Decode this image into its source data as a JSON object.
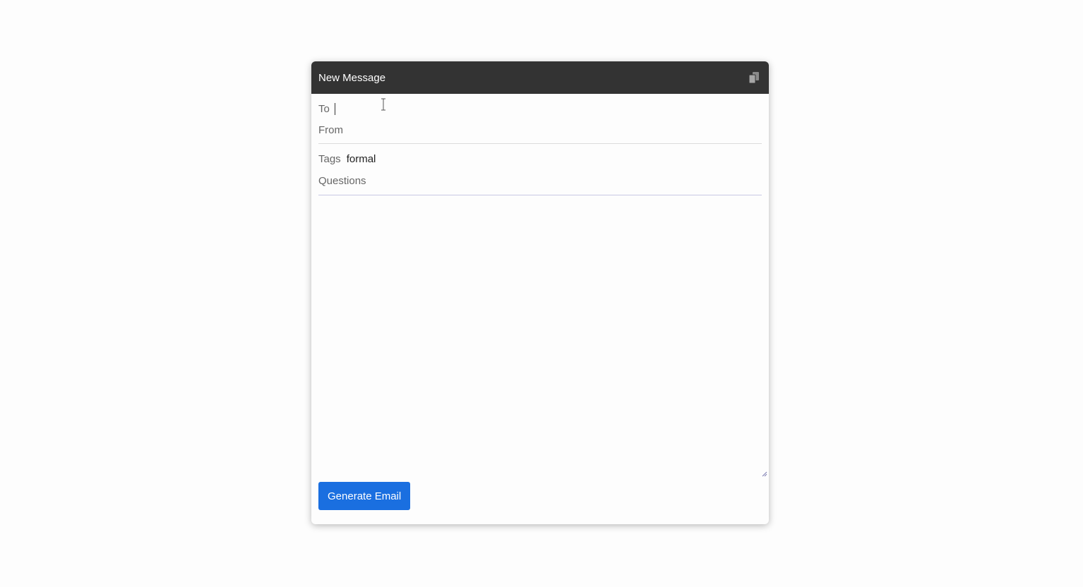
{
  "header": {
    "title": "New Message",
    "copy_icon": "copy-icon"
  },
  "fields": {
    "to_label": "To",
    "to_value": "",
    "from_label": "From",
    "from_value": "",
    "tags_label": "Tags",
    "tags_value": "formal",
    "questions_label": "Questions",
    "questions_value": ""
  },
  "body": {
    "value": ""
  },
  "footer": {
    "generate_label": "Generate Email"
  },
  "colors": {
    "header_bg": "#333333",
    "button_bg": "#1a6fe0",
    "page_bg": "#fdfdfd"
  }
}
